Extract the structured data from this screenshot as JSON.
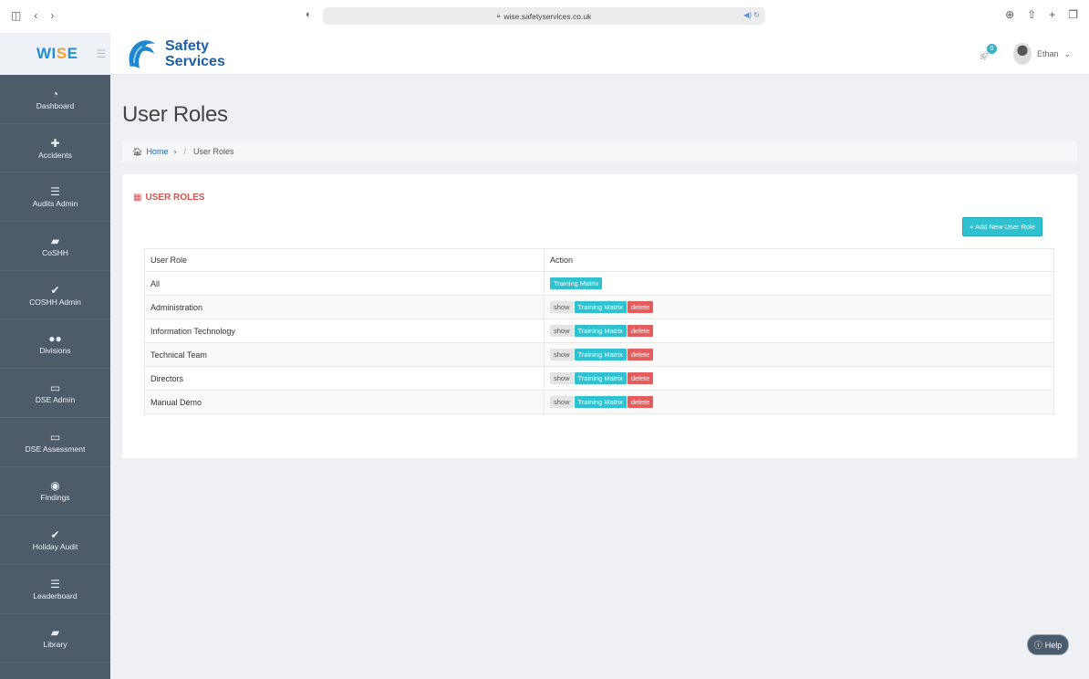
{
  "browser": {
    "url": "wise.safetyservices.co.uk"
  },
  "brand": {
    "app_name_prefix": "WI",
    "app_name_accent": "S",
    "app_name_suffix": "E",
    "logo_line1": "Safety",
    "logo_line2": "Services"
  },
  "header": {
    "notification_count": "0",
    "user_name": "Ethan"
  },
  "sidebar": {
    "items": [
      {
        "label": "Dashboard",
        "icon": "dashboard-icon"
      },
      {
        "label": "Accidents",
        "icon": "first-aid-icon"
      },
      {
        "label": "Audits Admin",
        "icon": "list-icon"
      },
      {
        "label": "CoSHH",
        "icon": "book-icon"
      },
      {
        "label": "COSHH Admin",
        "icon": "check-icon"
      },
      {
        "label": "Divisions",
        "icon": "users-icon"
      },
      {
        "label": "DSE Admin",
        "icon": "monitor-icon"
      },
      {
        "label": "DSE Assessment",
        "icon": "monitor-icon"
      },
      {
        "label": "Findings",
        "icon": "eye-icon"
      },
      {
        "label": "Holiday Audit",
        "icon": "check-icon"
      },
      {
        "label": "Leaderboard",
        "icon": "list-icon"
      },
      {
        "label": "Library",
        "icon": "book-icon"
      }
    ]
  },
  "page": {
    "title": "User Roles",
    "breadcrumb": {
      "home": "Home",
      "current": "User Roles"
    }
  },
  "panel": {
    "title": "USER ROLES",
    "add_button": "+ Add New User Role",
    "columns": {
      "role": "User Role",
      "action": "Action"
    },
    "actions": {
      "show": "show",
      "training_matrix": "Training Matrix",
      "delete": "delete"
    },
    "rows": [
      {
        "role": "All",
        "show": false,
        "delete": false
      },
      {
        "role": "Administration",
        "show": true,
        "delete": true
      },
      {
        "role": "Information Technology",
        "show": true,
        "delete": true
      },
      {
        "role": "Technical Team",
        "show": true,
        "delete": true
      },
      {
        "role": "Directors",
        "show": true,
        "delete": true
      },
      {
        "role": "Manual Demo",
        "show": true,
        "delete": true
      }
    ]
  },
  "help": {
    "label": "Help"
  },
  "colors": {
    "sidebar_bg": "#4e5b69",
    "accent_cyan": "#2fc1cf",
    "danger_red": "#e35d5d",
    "title_red": "#d9534f",
    "brand_blue": "#1b5fa8"
  }
}
